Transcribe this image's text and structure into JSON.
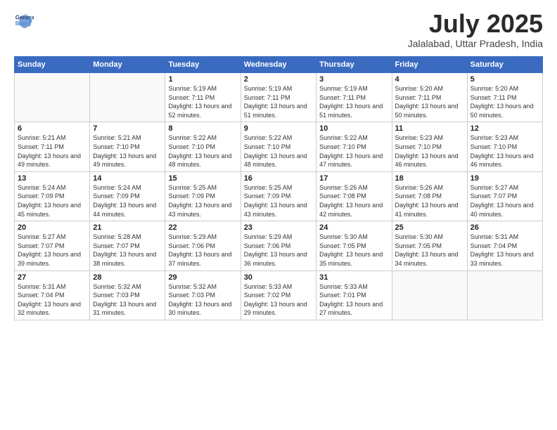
{
  "logo": {
    "line1": "General",
    "line2": "Blue"
  },
  "title": "July 2025",
  "subtitle": "Jalalabad, Uttar Pradesh, India",
  "headers": [
    "Sunday",
    "Monday",
    "Tuesday",
    "Wednesday",
    "Thursday",
    "Friday",
    "Saturday"
  ],
  "weeks": [
    [
      {
        "day": "",
        "sunrise": "",
        "sunset": "",
        "daylight": ""
      },
      {
        "day": "",
        "sunrise": "",
        "sunset": "",
        "daylight": ""
      },
      {
        "day": "1",
        "sunrise": "Sunrise: 5:19 AM",
        "sunset": "Sunset: 7:11 PM",
        "daylight": "Daylight: 13 hours and 52 minutes."
      },
      {
        "day": "2",
        "sunrise": "Sunrise: 5:19 AM",
        "sunset": "Sunset: 7:11 PM",
        "daylight": "Daylight: 13 hours and 51 minutes."
      },
      {
        "day": "3",
        "sunrise": "Sunrise: 5:19 AM",
        "sunset": "Sunset: 7:11 PM",
        "daylight": "Daylight: 13 hours and 51 minutes."
      },
      {
        "day": "4",
        "sunrise": "Sunrise: 5:20 AM",
        "sunset": "Sunset: 7:11 PM",
        "daylight": "Daylight: 13 hours and 50 minutes."
      },
      {
        "day": "5",
        "sunrise": "Sunrise: 5:20 AM",
        "sunset": "Sunset: 7:11 PM",
        "daylight": "Daylight: 13 hours and 50 minutes."
      }
    ],
    [
      {
        "day": "6",
        "sunrise": "Sunrise: 5:21 AM",
        "sunset": "Sunset: 7:11 PM",
        "daylight": "Daylight: 13 hours and 49 minutes."
      },
      {
        "day": "7",
        "sunrise": "Sunrise: 5:21 AM",
        "sunset": "Sunset: 7:10 PM",
        "daylight": "Daylight: 13 hours and 49 minutes."
      },
      {
        "day": "8",
        "sunrise": "Sunrise: 5:22 AM",
        "sunset": "Sunset: 7:10 PM",
        "daylight": "Daylight: 13 hours and 48 minutes."
      },
      {
        "day": "9",
        "sunrise": "Sunrise: 5:22 AM",
        "sunset": "Sunset: 7:10 PM",
        "daylight": "Daylight: 13 hours and 48 minutes."
      },
      {
        "day": "10",
        "sunrise": "Sunrise: 5:22 AM",
        "sunset": "Sunset: 7:10 PM",
        "daylight": "Daylight: 13 hours and 47 minutes."
      },
      {
        "day": "11",
        "sunrise": "Sunrise: 5:23 AM",
        "sunset": "Sunset: 7:10 PM",
        "daylight": "Daylight: 13 hours and 46 minutes."
      },
      {
        "day": "12",
        "sunrise": "Sunrise: 5:23 AM",
        "sunset": "Sunset: 7:10 PM",
        "daylight": "Daylight: 13 hours and 46 minutes."
      }
    ],
    [
      {
        "day": "13",
        "sunrise": "Sunrise: 5:24 AM",
        "sunset": "Sunset: 7:09 PM",
        "daylight": "Daylight: 13 hours and 45 minutes."
      },
      {
        "day": "14",
        "sunrise": "Sunrise: 5:24 AM",
        "sunset": "Sunset: 7:09 PM",
        "daylight": "Daylight: 13 hours and 44 minutes."
      },
      {
        "day": "15",
        "sunrise": "Sunrise: 5:25 AM",
        "sunset": "Sunset: 7:09 PM",
        "daylight": "Daylight: 13 hours and 43 minutes."
      },
      {
        "day": "16",
        "sunrise": "Sunrise: 5:25 AM",
        "sunset": "Sunset: 7:09 PM",
        "daylight": "Daylight: 13 hours and 43 minutes."
      },
      {
        "day": "17",
        "sunrise": "Sunrise: 5:26 AM",
        "sunset": "Sunset: 7:08 PM",
        "daylight": "Daylight: 13 hours and 42 minutes."
      },
      {
        "day": "18",
        "sunrise": "Sunrise: 5:26 AM",
        "sunset": "Sunset: 7:08 PM",
        "daylight": "Daylight: 13 hours and 41 minutes."
      },
      {
        "day": "19",
        "sunrise": "Sunrise: 5:27 AM",
        "sunset": "Sunset: 7:07 PM",
        "daylight": "Daylight: 13 hours and 40 minutes."
      }
    ],
    [
      {
        "day": "20",
        "sunrise": "Sunrise: 5:27 AM",
        "sunset": "Sunset: 7:07 PM",
        "daylight": "Daylight: 13 hours and 39 minutes."
      },
      {
        "day": "21",
        "sunrise": "Sunrise: 5:28 AM",
        "sunset": "Sunset: 7:07 PM",
        "daylight": "Daylight: 13 hours and 38 minutes."
      },
      {
        "day": "22",
        "sunrise": "Sunrise: 5:29 AM",
        "sunset": "Sunset: 7:06 PM",
        "daylight": "Daylight: 13 hours and 37 minutes."
      },
      {
        "day": "23",
        "sunrise": "Sunrise: 5:29 AM",
        "sunset": "Sunset: 7:06 PM",
        "daylight": "Daylight: 13 hours and 36 minutes."
      },
      {
        "day": "24",
        "sunrise": "Sunrise: 5:30 AM",
        "sunset": "Sunset: 7:05 PM",
        "daylight": "Daylight: 13 hours and 35 minutes."
      },
      {
        "day": "25",
        "sunrise": "Sunrise: 5:30 AM",
        "sunset": "Sunset: 7:05 PM",
        "daylight": "Daylight: 13 hours and 34 minutes."
      },
      {
        "day": "26",
        "sunrise": "Sunrise: 5:31 AM",
        "sunset": "Sunset: 7:04 PM",
        "daylight": "Daylight: 13 hours and 33 minutes."
      }
    ],
    [
      {
        "day": "27",
        "sunrise": "Sunrise: 5:31 AM",
        "sunset": "Sunset: 7:04 PM",
        "daylight": "Daylight: 13 hours and 32 minutes."
      },
      {
        "day": "28",
        "sunrise": "Sunrise: 5:32 AM",
        "sunset": "Sunset: 7:03 PM",
        "daylight": "Daylight: 13 hours and 31 minutes."
      },
      {
        "day": "29",
        "sunrise": "Sunrise: 5:32 AM",
        "sunset": "Sunset: 7:03 PM",
        "daylight": "Daylight: 13 hours and 30 minutes."
      },
      {
        "day": "30",
        "sunrise": "Sunrise: 5:33 AM",
        "sunset": "Sunset: 7:02 PM",
        "daylight": "Daylight: 13 hours and 29 minutes."
      },
      {
        "day": "31",
        "sunrise": "Sunrise: 5:33 AM",
        "sunset": "Sunset: 7:01 PM",
        "daylight": "Daylight: 13 hours and 27 minutes."
      },
      {
        "day": "",
        "sunrise": "",
        "sunset": "",
        "daylight": ""
      },
      {
        "day": "",
        "sunrise": "",
        "sunset": "",
        "daylight": ""
      }
    ]
  ]
}
